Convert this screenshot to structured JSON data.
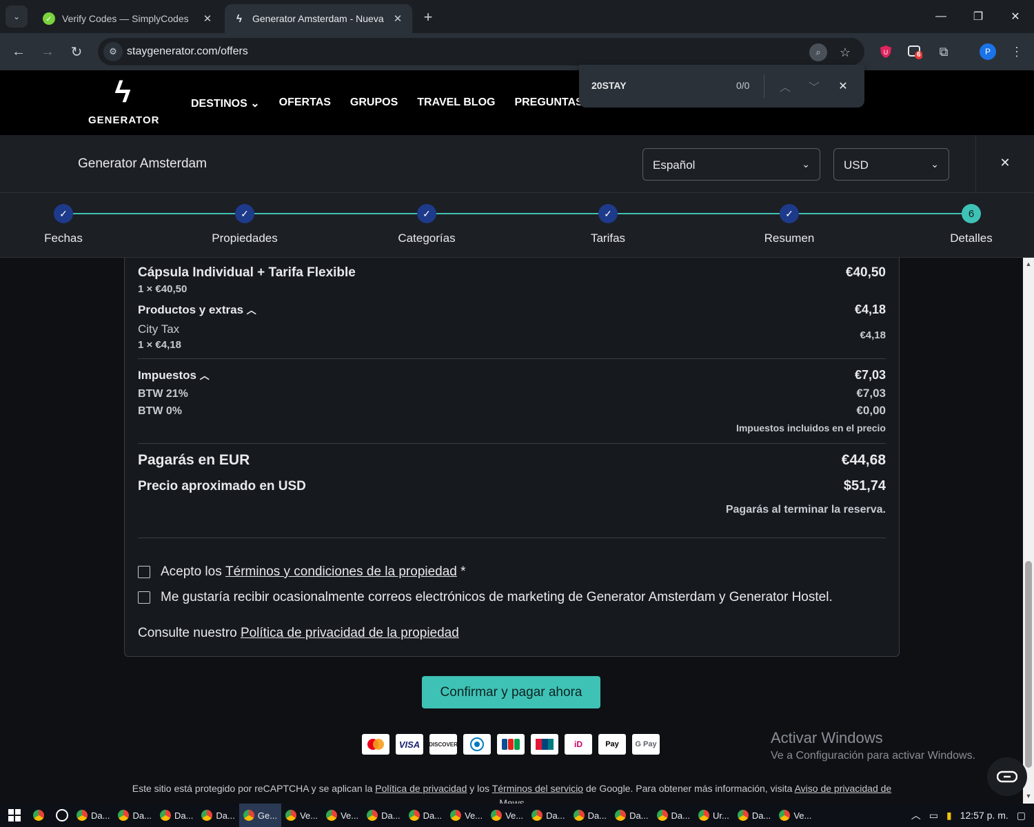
{
  "browser": {
    "tabs": [
      {
        "title": "Verify Codes — SimplyCodes",
        "favicon": "simplycodes-icon",
        "active": false
      },
      {
        "title": "Generator Amsterdam - Nueva",
        "favicon": "generator-icon",
        "active": true
      }
    ],
    "url": "staygenerator.com/offers",
    "extension_badge": "6",
    "profile_initial": "P"
  },
  "findbar": {
    "query": "20STAY",
    "count": "0/0"
  },
  "site": {
    "logo_text": "GENERATOR",
    "nav": [
      "DESTINOS",
      "OFERTAS",
      "GRUPOS",
      "TRAVEL BLOG",
      "PREGUNTAS FREC"
    ]
  },
  "property": {
    "name": "Generator Amsterdam",
    "language": "Español",
    "currency": "USD"
  },
  "steps": [
    {
      "label": "Fechas",
      "done": true
    },
    {
      "label": "Propiedades",
      "done": true
    },
    {
      "label": "Categorías",
      "done": true
    },
    {
      "label": "Tarifas",
      "done": true
    },
    {
      "label": "Resumen",
      "done": true
    },
    {
      "label": "Detalles",
      "number": "6",
      "done": false
    }
  ],
  "summary": {
    "room": {
      "title": "Cápsula Individual + Tarifa Flexible",
      "qty": "1 × €40,50",
      "price": "€40,50"
    },
    "extras": {
      "title": "Productos y extras",
      "total": "€4,18",
      "items": [
        {
          "name": "City Tax",
          "qty": "1 × €4,18",
          "price": "€4,18"
        }
      ]
    },
    "taxes": {
      "title": "Impuestos",
      "total": "€7,03",
      "items": [
        {
          "name": "BTW 21%",
          "price": "€7,03"
        },
        {
          "name": "BTW 0%",
          "price": "€0,00"
        }
      ],
      "note": "Impuestos incluidos en el precio"
    },
    "pay_eur": {
      "label": "Pagarás en EUR",
      "value": "€44,68"
    },
    "approx_usd": {
      "label": "Precio aproximado en USD",
      "value": "$51,74"
    },
    "pay_note": "Pagarás al terminar la reserva."
  },
  "consent": {
    "terms_prefix": "Acepto los",
    "terms_link": "Términos y condiciones de la propiedad",
    "terms_required": "*",
    "marketing": "Me gustaría recibir ocasionalmente correos electrónicos de marketing de Generator Amsterdam y Generator Hostel.",
    "privacy_prefix": "Consulte nuestro",
    "privacy_link": "Política de privacidad de la propiedad"
  },
  "cta_label": "Confirmar y pagar ahora",
  "payment_methods": [
    "Mastercard",
    "VISA",
    "DISCOVER",
    "Diners",
    "JCB",
    "UnionPay",
    "iDEAL",
    "Apple Pay",
    "G Pay"
  ],
  "watermark": {
    "title": "Activar Windows",
    "subtitle": "Ve a Configuración para activar Windows."
  },
  "recaptcha": {
    "p1": "Este sitio está protegido por reCAPTCHA y se aplican la",
    "privacy": "Política de privacidad",
    "p2": "y los",
    "terms": "Términos del servicio",
    "p3": "de Google. Para obtener más información, visita",
    "notice": "Aviso de privacidad de Mews"
  },
  "taskbar": {
    "items": [
      "Da...",
      "Da...",
      "Da...",
      "Da...",
      "Ge...",
      "Ve...",
      "Ve...",
      "Da...",
      "Da...",
      "Ve...",
      "Ve...",
      "Da...",
      "Da...",
      "Da...",
      "Da...",
      "Ur...",
      "Da...",
      "Ve..."
    ],
    "clock": "12:57 p. m."
  }
}
